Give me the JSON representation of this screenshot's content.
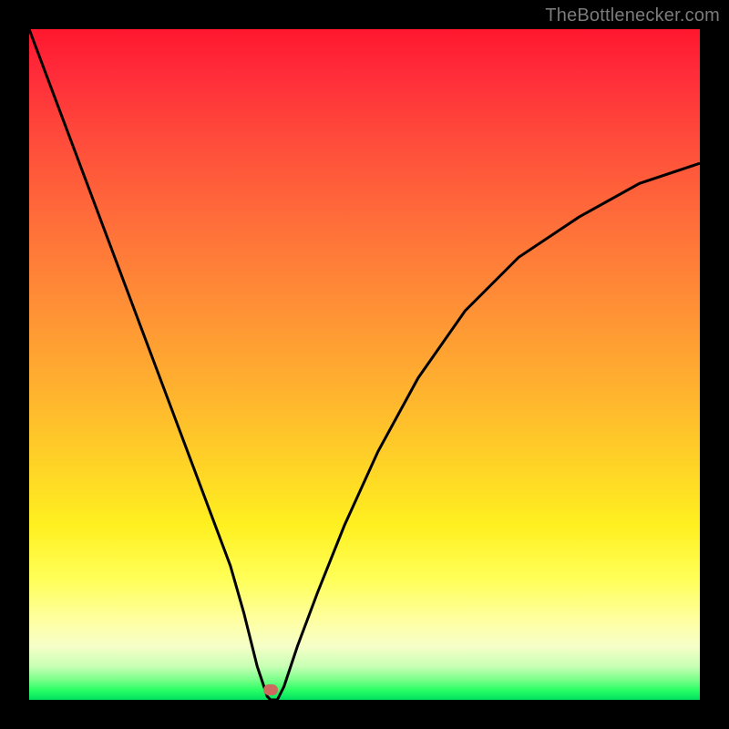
{
  "attribution": "TheBottlenecker.com",
  "colors": {
    "curve": "#000000",
    "marker": "#cc6a5f",
    "gradient_top": "#ff172e",
    "gradient_bottom": "#00e060",
    "frame": "#000000"
  },
  "chart_data": {
    "type": "line",
    "title": "",
    "xlabel": "",
    "ylabel": "",
    "xlim": [
      0,
      100
    ],
    "ylim": [
      0,
      100
    ],
    "series": [
      {
        "name": "bottleneck-curve",
        "x": [
          0,
          3,
          6,
          9,
          12,
          15,
          18,
          21,
          24,
          27,
          30,
          32,
          33,
          34,
          35,
          35.5,
          36,
          37,
          38,
          40,
          43,
          47,
          52,
          58,
          65,
          73,
          82,
          91,
          100
        ],
        "values": [
          100,
          92,
          84,
          76,
          68,
          60,
          52,
          44,
          36,
          28,
          20,
          13,
          9,
          5,
          2,
          0.5,
          0,
          0,
          2,
          8,
          16,
          26,
          37,
          48,
          58,
          66,
          72,
          77,
          80
        ]
      }
    ],
    "annotations": [
      {
        "name": "optimal-marker",
        "x": 36,
        "y": 1.5
      }
    ]
  }
}
